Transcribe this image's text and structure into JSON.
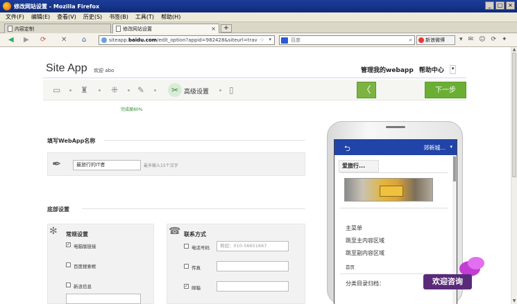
{
  "window": {
    "title": "修改网站设置 - Mozilla Firefox"
  },
  "menubar": {
    "items": [
      "文件(F)",
      "编辑(E)",
      "查看(V)",
      "历史(S)",
      "书签(B)",
      "工具(T)",
      "帮助(H)"
    ]
  },
  "tabs": [
    {
      "label": "内容定制"
    },
    {
      "label": "修改网站设置"
    }
  ],
  "nav": {
    "url_prefix": "siteapp.",
    "url_domain": "baidu.com",
    "url_rest": "/edit_option?appid=982428&siteurl=trav",
    "search_placeholder": "百度",
    "weibo_label": "新浪微博"
  },
  "header": {
    "brand": "Site App",
    "welcome": "欢迎 abo",
    "manage_link": "管理我的webapp",
    "help_link": "帮助中心",
    "help_dropdown": "▾"
  },
  "steps": {
    "current_label": "高级设置",
    "progress_text": "完成度80%",
    "prev_glyph": "〈",
    "next_label": "下一步"
  },
  "form": {
    "name_section_title": "填写WebApp名称",
    "name_value": "最旅行的IT者",
    "name_hint": "最多输入15个汉字",
    "footer_section_title": "底部设置",
    "common": {
      "title": "常规设置",
      "options": [
        {
          "label": "电脑版链接",
          "checked": true
        },
        {
          "label": "百度搜索框",
          "checked": false
        },
        {
          "label": "新浪信息",
          "checked": false
        }
      ]
    },
    "contact": {
      "title": "联系方式",
      "options": [
        {
          "label": "电话号码",
          "checked": false,
          "placeholder": "例如：010-56651667"
        },
        {
          "label": "传真",
          "checked": false,
          "placeholder": ""
        },
        {
          "label": "邮箱",
          "checked": true,
          "placeholder": ""
        }
      ]
    }
  },
  "preview": {
    "back_glyph": "⮌",
    "city": "郊新城...",
    "tab_label": "爱旅行...",
    "menu_title": "主菜单",
    "links": [
      "跳至主内容区域",
      "跳至副内容区域"
    ],
    "home": "首页",
    "category": "分类目录归档："
  },
  "consult": {
    "label": "欢迎咨询"
  },
  "colors": {
    "accent_green": "#6aae34",
    "app_bar_blue": "#2044a8",
    "titlebar_blue": "#1c3d99"
  }
}
